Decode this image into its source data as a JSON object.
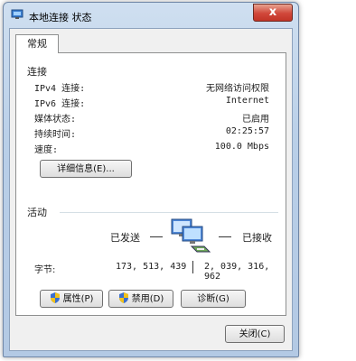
{
  "window": {
    "title": "本地连接 状态",
    "close_label": "x"
  },
  "tabs": [
    {
      "label": "常规"
    }
  ],
  "connection": {
    "section_label": "连接",
    "rows": [
      {
        "label": "IPv4 连接:",
        "value": "无网络访问权限"
      },
      {
        "label": "IPv6 连接:",
        "value": "Internet"
      },
      {
        "label": "媒体状态:",
        "value": "已启用"
      },
      {
        "label": "持续时间:",
        "value": "02:25:57"
      },
      {
        "label": "速度:",
        "value": "100.0 Mbps"
      }
    ],
    "details_button": "详细信息(E)..."
  },
  "activity": {
    "section_label": "活动",
    "sent_label": "已发送",
    "received_label": "已接收",
    "bytes_label": "字节:",
    "bytes_sent": "173, 513, 439",
    "bytes_received": "2, 039, 316, 962"
  },
  "buttons": {
    "properties": "属性(P)",
    "disable": "禁用(D)",
    "diagnose": "诊断(G)",
    "close": "关闭(C)"
  },
  "icons": {
    "title": "network-connection-icon",
    "activity": "network-computers-icon",
    "shield": "uac-shield-icon"
  }
}
